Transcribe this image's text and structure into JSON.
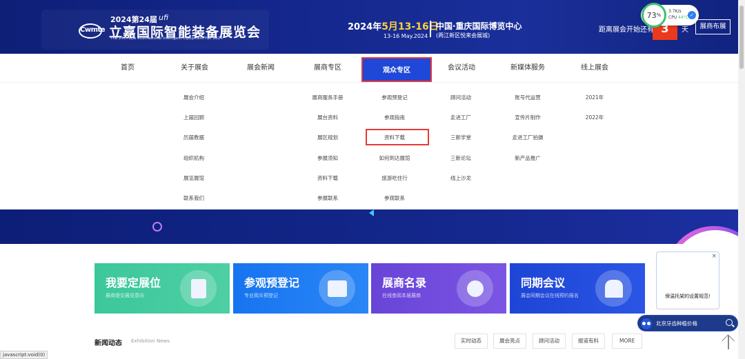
{
  "header": {
    "edition": "2024第24届",
    "ufi": "ufi",
    "logo_abbr": "Cwmte",
    "title": "立嘉国际智能装备展览会",
    "subtitle": "The 24th Lijia International Intelligent Equipment Fair 2024",
    "date_prefix": "2024年",
    "date_highlight": "5月13-16日",
    "date_en": "13-16 May.2024",
    "venue_main": "中国·重庆国际博览中心",
    "venue_sub": "(两江新区悦来会展城)",
    "countdown_label": "距离展会开始还有",
    "countdown_value": "3",
    "countdown_unit": "天",
    "layout_button": "展商布展"
  },
  "cpu_widget": {
    "percent": "73",
    "percent_unit": "%",
    "net_speed": "3.7K/s",
    "cpu_label": "CPU",
    "cpu_temp": "44°C"
  },
  "nav": {
    "items": [
      "首页",
      "关于展会",
      "展会新闻",
      "展商专区",
      "观众专区",
      "会议活动",
      "新媒体服务",
      "线上展会"
    ]
  },
  "dropdown": {
    "about": [
      "展会介绍",
      "上届回顾",
      "历届数据",
      "组织机构",
      "展览展馆",
      "联系我们"
    ],
    "exhibitor": [
      "展商服务手册",
      "展台资料",
      "展区规划",
      "参展须知",
      "资料下载",
      "参展联系"
    ],
    "visitor": [
      "参观预登记",
      "参观指南",
      "资料下载",
      "如何到达展馆",
      "旅游吃住行",
      "参观联系"
    ],
    "events": [
      "顾问活动",
      "走进工厂",
      "三新学堂",
      "三新论坛",
      "线上沙龙"
    ],
    "media": [
      "账号代运营",
      "宣传片制作",
      "走进工厂拍摄",
      "新产品推广"
    ],
    "online": [
      "2021年",
      "2022年"
    ]
  },
  "cards": [
    {
      "title": "我要定展位",
      "sub": "展商提交展览意向"
    },
    {
      "title": "参观预登记",
      "sub": "专业观众预登记"
    },
    {
      "title": "展商名录",
      "sub": "在线查阅本届展商"
    },
    {
      "title": "同期会议",
      "sub": "展会同期会议在线预约报名"
    }
  ],
  "news": {
    "title": "新闻动态",
    "subtitle": "Exhibition News",
    "tabs": [
      "实时动态",
      "展会亮点",
      "顾问活动",
      "报道有料",
      "MORE"
    ]
  },
  "popup": {
    "close": "×",
    "text": "保温托架的设置规范!"
  },
  "search_pill": {
    "label": "北京牙齿种植价格"
  },
  "status_bar": "javascript:void(0)",
  "colors": {
    "header_bg": "#14278d",
    "nav_active": "#1f48d8",
    "highlight_border": "#e53935",
    "countdown_bg": "#ea3a1e",
    "card_green": "#3cc79b",
    "card_blue": "#1774f0",
    "card_purple": "#6844d8",
    "card_royal": "#1d45d6"
  }
}
